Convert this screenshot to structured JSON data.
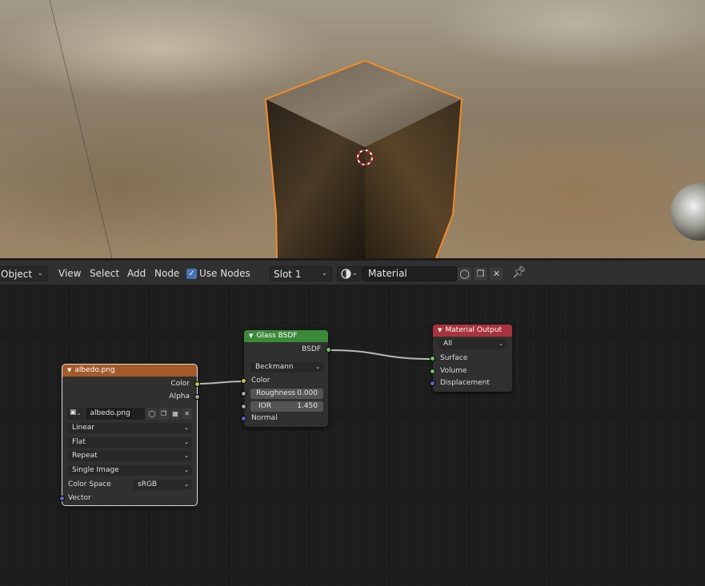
{
  "header": {
    "mode": "Object",
    "menus": [
      "View",
      "Select",
      "Add",
      "Node"
    ],
    "use_nodes_label": "Use Nodes",
    "use_nodes_checked": true,
    "slot": "Slot 1",
    "material_name": "Material"
  },
  "nodes": {
    "image_texture": {
      "title": "albedo.png",
      "outputs": [
        "Color",
        "Alpha"
      ],
      "image_name": "albedo.png",
      "interpolation": "Linear",
      "projection": "Flat",
      "extension": "Repeat",
      "source": "Single Image",
      "color_space_label": "Color Space",
      "color_space": "sRGB",
      "input": "Vector"
    },
    "glass_bsdf": {
      "title": "Glass BSDF",
      "output": "BSDF",
      "distribution": "Beckmann",
      "color_label": "Color",
      "roughness_label": "Roughness",
      "roughness_value": "0.000",
      "ior_label": "IOR",
      "ior_value": "1.450",
      "normal_label": "Normal"
    },
    "material_output": {
      "title": "Material Output",
      "target": "All",
      "inputs": [
        "Surface",
        "Volume",
        "Displacement"
      ]
    }
  },
  "colors": {
    "texture_header": "#a55a2a",
    "shader_header": "#3a8a3a",
    "output_header": "#a8333c",
    "color_socket": "#c7c729",
    "gray_socket": "#a1a1a1",
    "vector_socket": "#6363c7",
    "shader_socket": "#63c763",
    "selection": "#f08c28"
  }
}
